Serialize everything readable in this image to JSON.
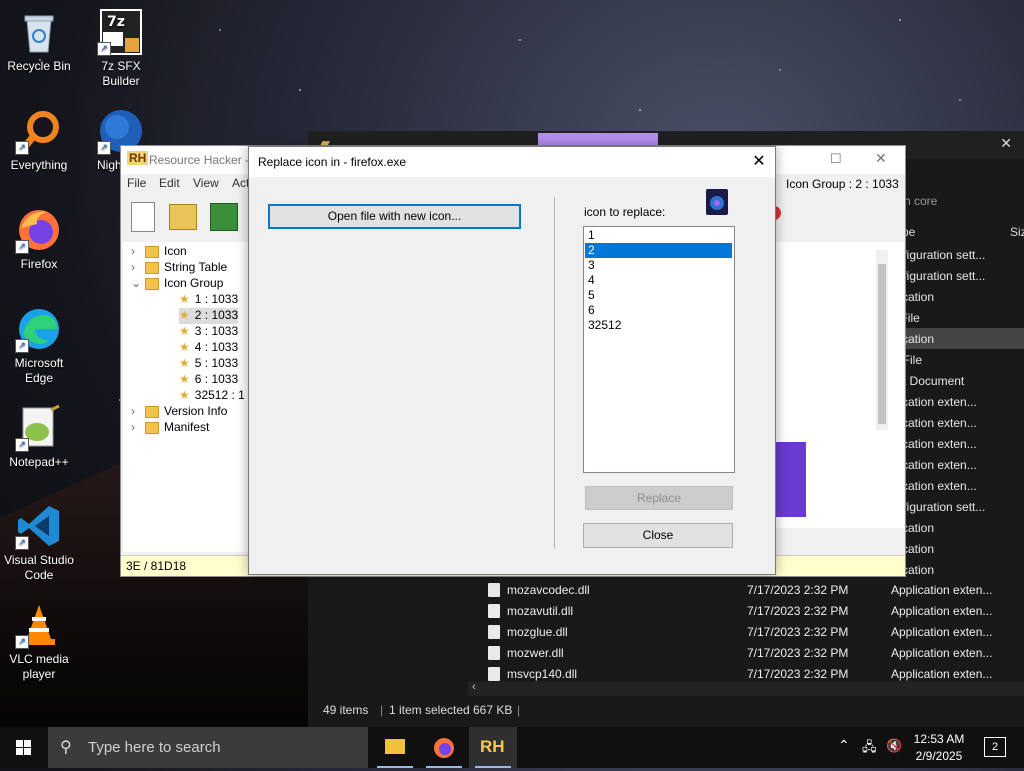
{
  "desktop": {
    "icons": [
      {
        "label": "Recycle Bin",
        "icon": "recycle-bin-icon"
      },
      {
        "label": "7z SFX Builder",
        "icon": "7z-sfx-icon"
      },
      {
        "label": "Everything",
        "icon": "everything-search-icon"
      },
      {
        "label": "Nigh",
        "icon": "nightly-browser-icon"
      },
      {
        "label": "Firefox",
        "icon": "firefox-icon"
      },
      {
        "label": "Microsoft Edge",
        "icon": "edge-icon"
      },
      {
        "label": "Notepad++",
        "icon": "notepadpp-icon"
      },
      {
        "label": "Visual Studio Code",
        "icon": "vscode-icon"
      },
      {
        "label": "VLC media player",
        "icon": "vlc-icon"
      }
    ]
  },
  "explorer": {
    "search_placeholder": "rch core",
    "col_type": "pe",
    "col_size": "Siz",
    "type_column": [
      "onfiguration sett...",
      "onfiguration sett...",
      "plication",
      "T File",
      "plication",
      "G File",
      "ML Document",
      "plication exten...",
      "plication exten...",
      "plication exten...",
      "plication exten...",
      "plication exten...",
      "onfiguration sett...",
      "plication",
      "plication",
      "plication"
    ],
    "files": [
      {
        "name": "mozavcodec.dll",
        "date": "7/17/2023 2:32 PM",
        "type": "Application exten..."
      },
      {
        "name": "mozavutil.dll",
        "date": "7/17/2023 2:32 PM",
        "type": "Application exten..."
      },
      {
        "name": "mozglue.dll",
        "date": "7/17/2023 2:32 PM",
        "type": "Application exten..."
      },
      {
        "name": "mozwer.dll",
        "date": "7/17/2023 2:32 PM",
        "type": "Application exten..."
      },
      {
        "name": "msvcp140.dll",
        "date": "7/17/2023 2:32 PM",
        "type": "Application exten..."
      }
    ],
    "status": {
      "items": "49 items",
      "selected": "1 item selected",
      "size": "667 KB"
    }
  },
  "resource_hacker": {
    "title": "Resource Hacker -",
    "logo": "RH",
    "menu": [
      "File",
      "Edit",
      "View",
      "Act"
    ],
    "icon_group_label": "Icon Group : 2 : 1033",
    "tree": [
      {
        "label": "Icon",
        "type": "folder",
        "expander": "›"
      },
      {
        "label": "String Table",
        "type": "folder",
        "expander": "›"
      },
      {
        "label": "Icon Group",
        "type": "folder",
        "expander": "⌄"
      },
      {
        "label": "1 : 1033",
        "type": "star"
      },
      {
        "label": "2 : 1033",
        "type": "star",
        "selected": true
      },
      {
        "label": "3 : 1033",
        "type": "star"
      },
      {
        "label": "4 : 1033",
        "type": "star"
      },
      {
        "label": "5 : 1033",
        "type": "star"
      },
      {
        "label": "6 : 1033",
        "type": "star"
      },
      {
        "label": "32512 : 1",
        "type": "star"
      },
      {
        "label": "Version Info",
        "type": "folder",
        "expander": "›"
      },
      {
        "label": "Manifest",
        "type": "folder",
        "expander": "›"
      }
    ],
    "status": "3E / 81D18"
  },
  "dialog": {
    "title": "Replace icon in - firefox.exe",
    "open_button": "Open file with new icon...",
    "icon_to_replace_label": "icon to replace:",
    "list": [
      "1",
      "2",
      "3",
      "4",
      "5",
      "6",
      "32512"
    ],
    "selected_index": 1,
    "replace_button": "Replace",
    "close_button": "Close"
  },
  "taskbar": {
    "search_placeholder": "Type here to search",
    "time": "12:53 AM",
    "date": "2/9/2025",
    "notification_count": "2"
  }
}
